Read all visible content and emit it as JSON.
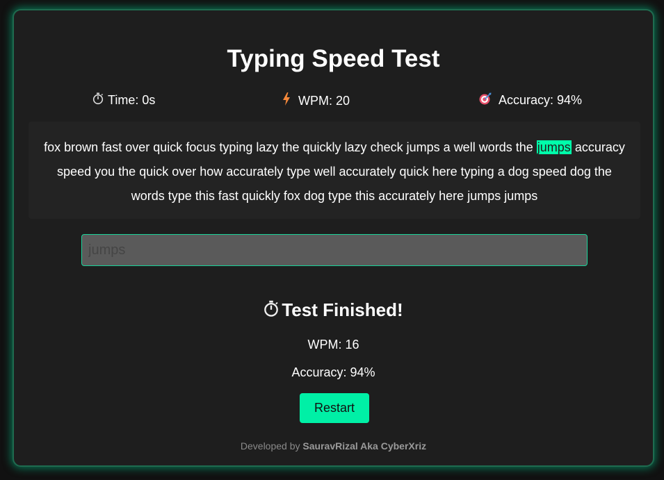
{
  "app": {
    "title": "Typing Speed Test"
  },
  "stats": {
    "time_icon": "stopwatch-icon",
    "time": "Time: 0s",
    "wpm_icon": "lightning-icon",
    "wpm": "WPM: 20",
    "accuracy_icon": "target-icon",
    "accuracy": "Accuracy: 94%"
  },
  "passage": {
    "words": [
      "fox",
      "brown",
      "fast",
      "over",
      "quick",
      "focus",
      "typing",
      "lazy",
      "the",
      "quickly",
      "lazy",
      "check",
      "jumps",
      "a",
      "well",
      "words",
      "the",
      "jumps",
      "accuracy",
      "speed",
      "you",
      "the",
      "quick",
      "over",
      "how",
      "accurately",
      "type",
      "well",
      "accurately",
      "quick",
      "here",
      "typing",
      "a",
      "dog",
      "speed",
      "dog",
      "the",
      "words",
      "type",
      "this",
      "fast",
      "quickly",
      "fox",
      "dog",
      "type",
      "this",
      "accurately",
      "here",
      "jumps",
      "jumps"
    ],
    "current_index": 17
  },
  "input": {
    "placeholder": "jumps",
    "value": ""
  },
  "results": {
    "icon": "stopwatch-icon",
    "title": "Test Finished!",
    "wpm": "WPM: 16",
    "accuracy": "Accuracy: 94%"
  },
  "restart_label": "Restart",
  "footer": {
    "prefix": "Developed by",
    "author": "SauravRizal Aka CyberXriz"
  },
  "colors": {
    "accent": "#00f0a6",
    "highlight": "#00ffaa",
    "card_background": "#1e1e1e",
    "passage_background": "#232323",
    "input_background": "#5a5a5a"
  }
}
